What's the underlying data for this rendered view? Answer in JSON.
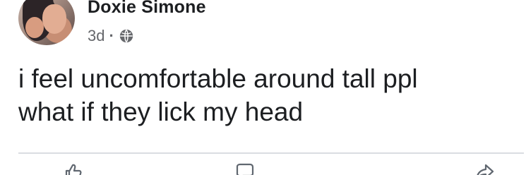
{
  "post": {
    "author": "Doxie Simone",
    "time": "3d",
    "separator": "·",
    "privacy_icon": "globe-icon",
    "text_lines": [
      "i feel uncomfortable around tall ppl",
      "what if they lick my head"
    ]
  },
  "actions": {
    "icons": [
      "like-icon",
      "comment-icon",
      "share-icon"
    ]
  },
  "colors": {
    "text": "#1c1e21",
    "meta": "#65676b",
    "divider": "#dadde1"
  }
}
